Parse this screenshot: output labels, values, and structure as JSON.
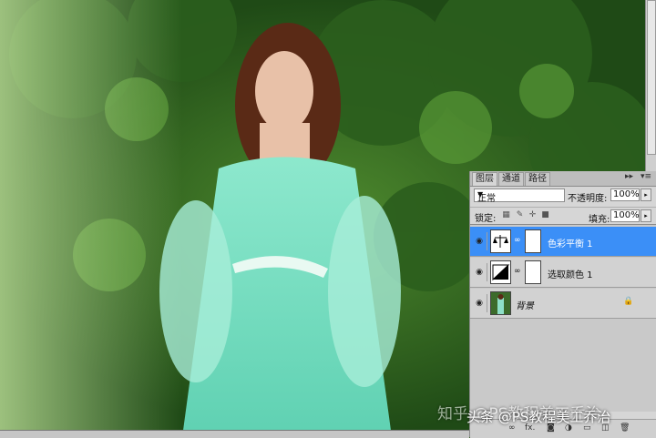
{
  "photo": {
    "description_icon": "photo-canvas"
  },
  "panel": {
    "tabs": [
      {
        "label": "图层"
      },
      {
        "label": "通道"
      },
      {
        "label": "路径"
      }
    ],
    "collapse_icon": "double-chevron-right-icon",
    "menu_icon": "panel-menu-icon",
    "blend_mode": "正常",
    "opacity_label": "不透明度:",
    "opacity_value": "100%",
    "lock_label": "锁定:",
    "fill_label": "填充:",
    "fill_value": "100%",
    "layers": [
      {
        "name": "色彩平衡 1",
        "type": "color-balance-adjustment",
        "visible": true,
        "selected": true
      },
      {
        "name": "选取颜色 1",
        "type": "selective-color-adjustment",
        "visible": true,
        "selected": false
      },
      {
        "name": "背景",
        "type": "background",
        "visible": true,
        "selected": false,
        "locked": true
      }
    ]
  },
  "watermark": "知乎 @PS教程美工乔治",
  "watermark2": "头条 @PS教程美工乔治",
  "colors": {
    "selected": "#3b8ff7",
    "panel_bg": "#d6d6d6"
  }
}
